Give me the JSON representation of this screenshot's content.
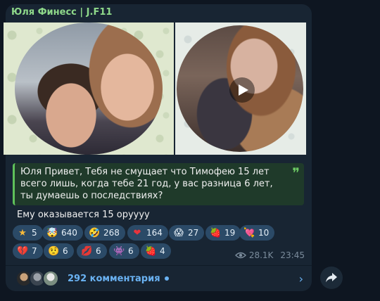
{
  "channel": {
    "name": "Юля Финесс | J.F11"
  },
  "quote": {
    "text": "Юля Привет, Тебя не смущает что Тимофею 15 лет всего лишь, когда тебе 21 год, у вас разница 6 лет, ты думаешь о последствиях?",
    "mark": "❞"
  },
  "message": {
    "text": "Ему оказывается 15 оруууу"
  },
  "reactions": [
    {
      "emoji": "★",
      "count": "5"
    },
    {
      "emoji": "🤯",
      "count": "640"
    },
    {
      "emoji": "🤣",
      "count": "268"
    },
    {
      "emoji": "❤",
      "count": "164"
    },
    {
      "emoji": "😱",
      "count": "27"
    },
    {
      "emoji": "🍓",
      "count": "19"
    },
    {
      "emoji": "💘",
      "count": "10"
    },
    {
      "emoji": "💔",
      "count": "7"
    },
    {
      "emoji": "🤨",
      "count": "6"
    },
    {
      "emoji": "💋",
      "count": "6"
    },
    {
      "emoji": "👾",
      "count": "6"
    },
    {
      "emoji": "🍓",
      "count": "4"
    }
  ],
  "meta": {
    "views": "28.1K",
    "time": "23:45"
  },
  "comments": {
    "label": "292 комментария",
    "chevron": "›"
  },
  "colors": {
    "accent": "#6ab2f2",
    "channel_name": "#8fd98a",
    "bubble": "#182533",
    "reaction_bg": "#2b4a67"
  }
}
